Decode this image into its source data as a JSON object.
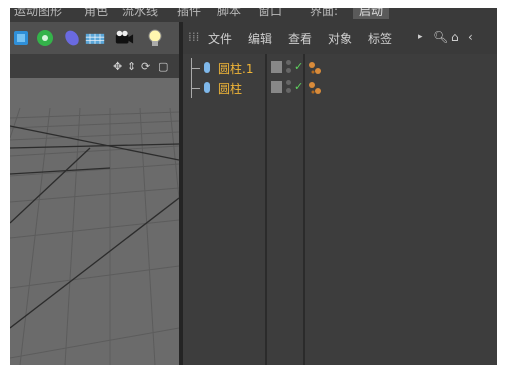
{
  "app_menu": {
    "items": [
      "运动图形",
      "角色",
      "流水线",
      "插件",
      "脚本",
      "窗口",
      "界面:",
      "启动"
    ]
  },
  "object_manager": {
    "menu": [
      "文件",
      "编辑",
      "查看",
      "对象",
      "标签"
    ],
    "objects": [
      {
        "name": "圆柱.1",
        "enabled": true
      },
      {
        "name": "圆柱",
        "enabled": true
      }
    ],
    "check_glyph": "✓"
  },
  "viewport": {
    "nav_icons": [
      "move-icon",
      "zoom-icon",
      "rotate-icon",
      "maximize-icon"
    ]
  },
  "colors": {
    "object_name": "#f0b537",
    "cylinder_icon": "#7fb8ea",
    "check": "#5ed45e",
    "tag": "#d98b3a"
  }
}
